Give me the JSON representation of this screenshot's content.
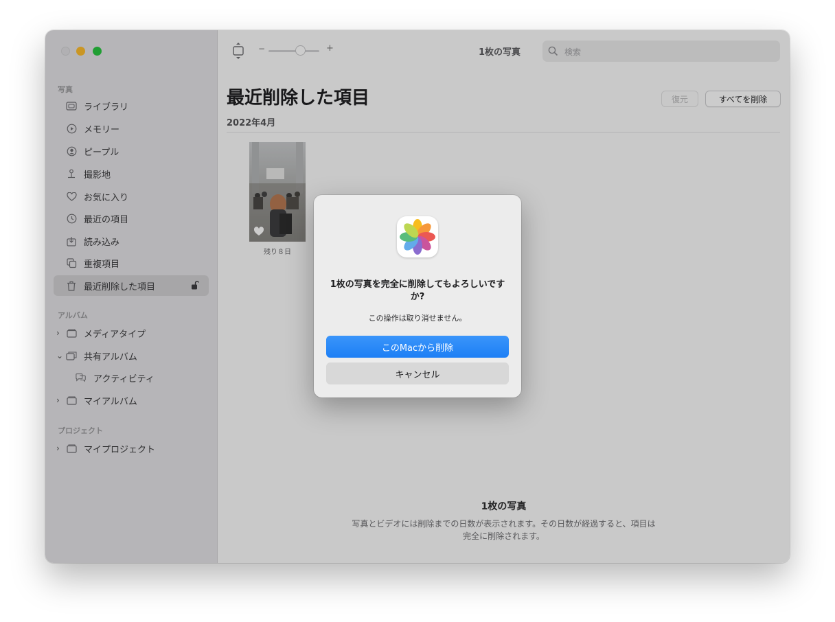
{
  "window": {
    "toolbar_count": "1枚の写真"
  },
  "search": {
    "placeholder": "検索"
  },
  "zoom": {
    "minus": "−",
    "plus": "+"
  },
  "sidebar": {
    "sections": {
      "photos": "写真",
      "albums": "アルバム",
      "projects": "プロジェクト"
    },
    "items": [
      {
        "label": "ライブラリ",
        "icon": "library-icon"
      },
      {
        "label": "メモリー",
        "icon": "memories-icon"
      },
      {
        "label": "ピープル",
        "icon": "people-icon"
      },
      {
        "label": "撮影地",
        "icon": "places-icon"
      },
      {
        "label": "お気に入り",
        "icon": "heart-icon"
      },
      {
        "label": "最近の項目",
        "icon": "clock-icon"
      },
      {
        "label": "読み込み",
        "icon": "import-icon"
      },
      {
        "label": "重複項目",
        "icon": "duplicates-icon"
      },
      {
        "label": "最近削除した項目",
        "icon": "trash-icon"
      }
    ],
    "albums": [
      {
        "label": "メディアタイプ",
        "chevron": "›"
      },
      {
        "label": "共有アルバム",
        "chevron": "⌄"
      },
      {
        "label": "アクティビティ",
        "chevron": ""
      },
      {
        "label": "マイアルバム",
        "chevron": "›"
      }
    ],
    "projects": [
      {
        "label": "マイプロジェクト",
        "chevron": "›"
      }
    ]
  },
  "main": {
    "title": "最近削除した項目",
    "date_header": "2022年4月",
    "restore_label": "復元",
    "delete_all_label": "すべてを削除",
    "thumb_label": "残り８日",
    "footer_title": "1枚の写真",
    "footer_text": "写真とビデオには削除までの日数が表示されます。その日数が経過すると、項目は完全に削除されます。"
  },
  "dialog": {
    "title": "1枚の写真を完全に削除してもよろしいですか?",
    "message": "この操作は取り消せません。",
    "confirm_label": "このMacから削除",
    "cancel_label": "キャンセル"
  },
  "colors": {
    "accent": "#1d7ff5",
    "sidebar_bg": "#e4e3e6",
    "traffic_min": "#fdbc2e",
    "traffic_max": "#29c640"
  }
}
